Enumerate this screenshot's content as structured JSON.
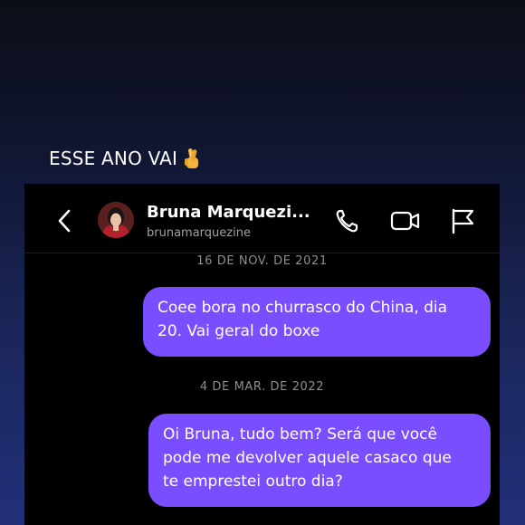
{
  "caption": {
    "text": "ESSE ANO VAI",
    "emoji": "crossed-fingers"
  },
  "chat": {
    "contact_name": "Bruna Marquezi...",
    "contact_handle": "brunamarquezine",
    "header_icons": [
      "back-icon",
      "phone-icon",
      "video-icon",
      "flag-icon"
    ],
    "messages": [
      {
        "date": "16 DE NOV. DE 2021",
        "lines": [
          "Coee bora no churrasco do China, dia",
          "20. Vai geral do boxe"
        ]
      },
      {
        "date": "4 DE MAR. DE 2022",
        "lines": [
          "Oi Bruna, tudo bem? Será que você",
          "pode me devolver aquele casaco que",
          "te emprestei outro dia?"
        ]
      }
    ]
  },
  "colors": {
    "bubble": "#7a4dff",
    "chat_background": "#000000",
    "date_text": "#8e8e93"
  }
}
